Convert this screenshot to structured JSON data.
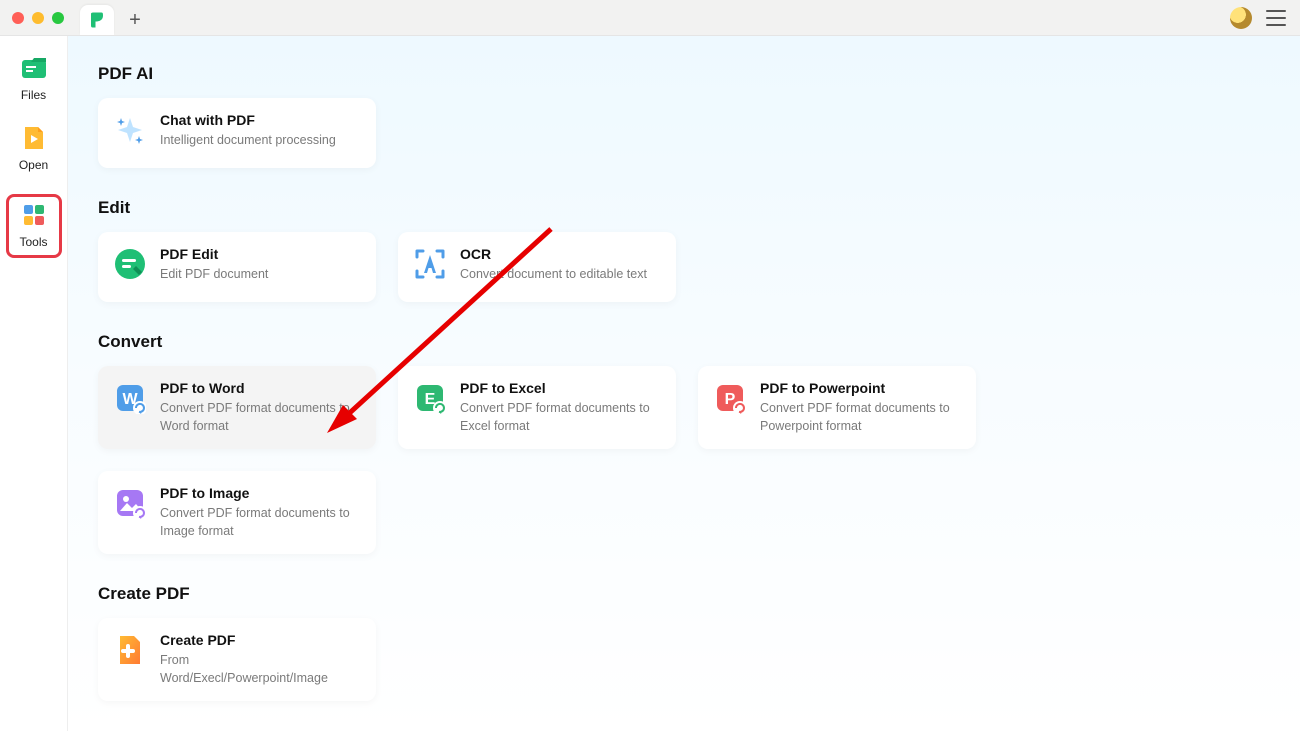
{
  "sidebar": {
    "items": [
      {
        "label": "Files"
      },
      {
        "label": "Open"
      },
      {
        "label": "Tools"
      }
    ]
  },
  "sections": {
    "pdf_ai": {
      "heading": "PDF AI",
      "cards": [
        {
          "title": "Chat with PDF",
          "sub": "Intelligent document processing"
        }
      ]
    },
    "edit": {
      "heading": "Edit",
      "cards": [
        {
          "title": "PDF Edit",
          "sub": "Edit PDF document"
        },
        {
          "title": "OCR",
          "sub": "Convert document to editable text"
        }
      ]
    },
    "convert": {
      "heading": "Convert",
      "cards": [
        {
          "title": "PDF to Word",
          "sub": "Convert PDF format documents to Word format"
        },
        {
          "title": "PDF to Excel",
          "sub": "Convert PDF format documents to Excel format"
        },
        {
          "title": "PDF to Powerpoint",
          "sub": "Convert PDF format documents to Powerpoint format"
        },
        {
          "title": "PDF to Image",
          "sub": "Convert PDF format documents to Image format"
        }
      ]
    },
    "create": {
      "heading": "Create PDF",
      "cards": [
        {
          "title": "Create PDF",
          "sub": "From Word/Execl/Powerpoint/Image"
        }
      ]
    }
  },
  "colors": {
    "accent_green": "#1fbf75",
    "accent_orange": "#ff9f1c",
    "accent_red": "#e63946",
    "word_blue": "#4f9de8",
    "excel_green": "#2eb872",
    "ppt_red": "#ef5b5b",
    "image_purple": "#a678f4"
  }
}
